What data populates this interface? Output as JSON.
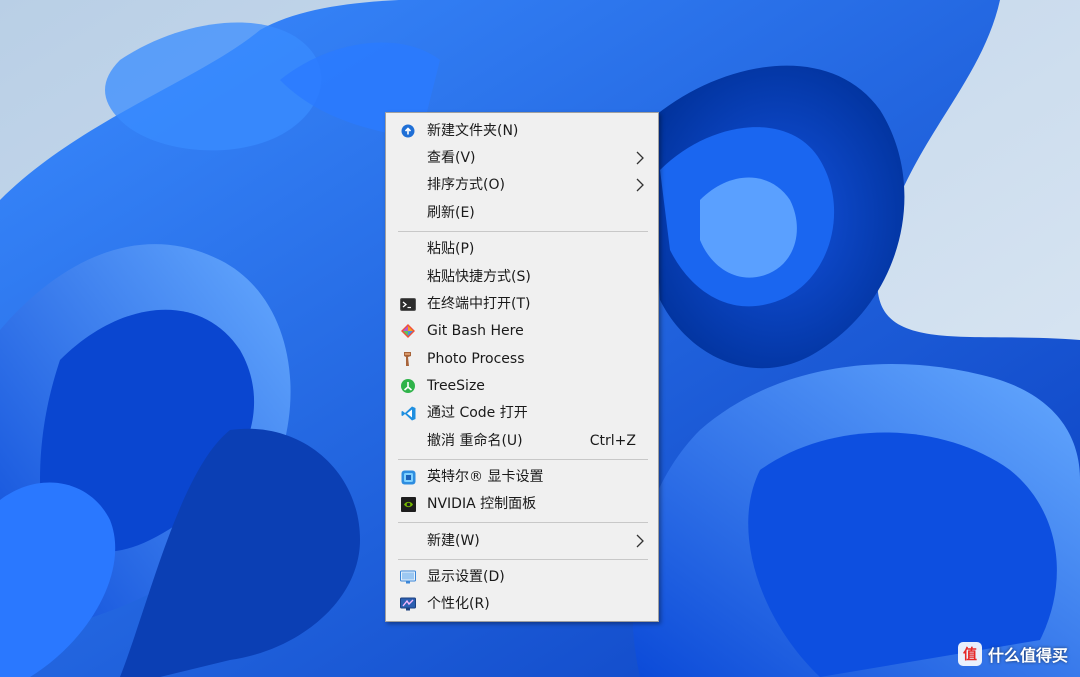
{
  "context_menu": {
    "items": [
      {
        "label": "新建文件夹(N)",
        "icon": "new-folder-icon"
      },
      {
        "label": "查看(V)",
        "submenu": true
      },
      {
        "label": "排序方式(O)",
        "submenu": true
      },
      {
        "label": "刷新(E)"
      },
      {
        "label": "粘贴(P)"
      },
      {
        "label": "粘贴快捷方式(S)"
      },
      {
        "label": "在终端中打开(T)",
        "icon": "terminal-icon"
      },
      {
        "label": "Git Bash Here",
        "icon": "git-bash-icon"
      },
      {
        "label": "Photo Process",
        "icon": "photo-process-icon"
      },
      {
        "label": "TreeSize",
        "icon": "treesize-icon"
      },
      {
        "label": "通过 Code 打开",
        "icon": "vscode-icon"
      },
      {
        "label": "撤消 重命名(U)",
        "shortcut": "Ctrl+Z"
      },
      {
        "label": "英特尔® 显卡设置",
        "icon": "intel-graphics-icon"
      },
      {
        "label": "NVIDIA 控制面板",
        "icon": "nvidia-icon"
      },
      {
        "label": "新建(W)",
        "submenu": true
      },
      {
        "label": "显示设置(D)",
        "icon": "display-settings-icon"
      },
      {
        "label": "个性化(R)",
        "icon": "personalize-icon"
      }
    ]
  },
  "watermark": {
    "text": "什么值得买"
  },
  "colors": {
    "menu_bg": "#f0f0f0",
    "wallpaper_blue": "#0a5ce8",
    "wallpaper_bg": "#cfe0f1"
  }
}
